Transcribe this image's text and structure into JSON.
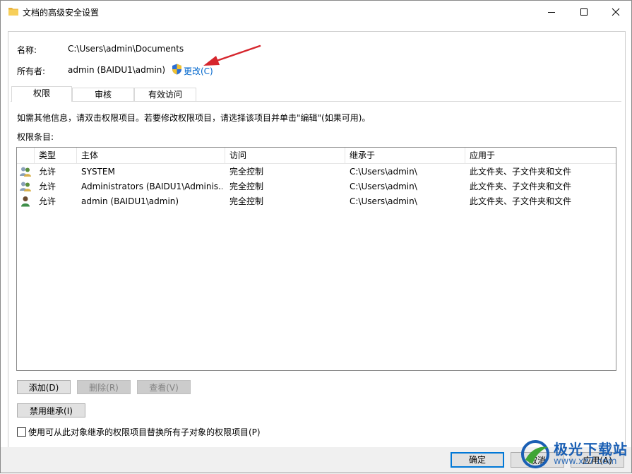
{
  "window": {
    "title": "文档的高级安全设置",
    "icon": "folder-icon"
  },
  "fields": {
    "name_label": "名称:",
    "name_value": "C:\\Users\\admin\\Documents",
    "owner_label": "所有者:",
    "owner_value": "admin (BAIDU1\\admin)",
    "change_link": "更改(C)"
  },
  "tabs": [
    {
      "label": "权限",
      "active": true
    },
    {
      "label": "审核",
      "active": false
    },
    {
      "label": "有效访问",
      "active": false
    }
  ],
  "info_text": "如需其他信息，请双击权限项目。若要修改权限项目，请选择该项目并单击\"编辑\"(如果可用)。",
  "entries_label": "权限条目:",
  "table": {
    "columns": [
      "类型",
      "主体",
      "访问",
      "继承于",
      "应用于"
    ],
    "rows": [
      {
        "icon": "group-users-icon",
        "type": "允许",
        "principal": "SYSTEM",
        "access": "完全控制",
        "inherited": "C:\\Users\\admin\\",
        "applies": "此文件夹、子文件夹和文件"
      },
      {
        "icon": "group-users-icon",
        "type": "允许",
        "principal": "Administrators (BAIDU1\\Adminis...",
        "access": "完全控制",
        "inherited": "C:\\Users\\admin\\",
        "applies": "此文件夹、子文件夹和文件"
      },
      {
        "icon": "user-icon",
        "type": "允许",
        "principal": "admin (BAIDU1\\admin)",
        "access": "完全控制",
        "inherited": "C:\\Users\\admin\\",
        "applies": "此文件夹、子文件夹和文件"
      }
    ]
  },
  "buttons": {
    "add": "添加(D)",
    "remove": "删除(R)",
    "view": "查看(V)",
    "disable_inheritance": "禁用继承(I)",
    "ok": "确定",
    "cancel": "取消",
    "apply": "应用(A)"
  },
  "checkbox": {
    "label": "使用可从此对象继承的权限项目替换所有子对象的权限项目(P)",
    "checked": false
  },
  "watermark": {
    "text": "极光下载站",
    "url": "www.xz7.com"
  },
  "colors": {
    "link": "#0066cc",
    "default_button_border": "#0078d7",
    "annotation_arrow": "#d6262d"
  }
}
